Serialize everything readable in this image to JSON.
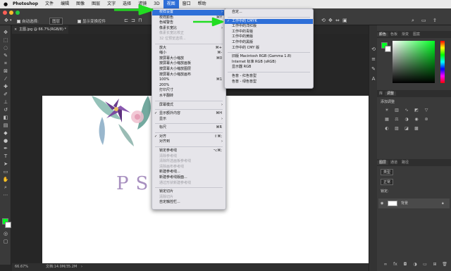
{
  "menubar": {
    "apple": "",
    "items": [
      "Photoshop",
      "文件",
      "编辑",
      "图像",
      "图层",
      "文字",
      "选择",
      "滤镜",
      "3D",
      "视图",
      "窗口",
      "帮助"
    ],
    "active_index": 9
  },
  "options_bar": {
    "auto_select_label": "自动选择:",
    "auto_select_value": "图层",
    "show_transform_label": "显示变换控件"
  },
  "document": {
    "tab_label": "主图.jpg @ 66.7%(RGB/8) *",
    "close_glyph": "×",
    "canvas_text": "PS 部落",
    "status_zoom": "66.67%",
    "status_doc": "文档:14.0M/35.2M"
  },
  "view_menu": [
    {
      "label": "校样设置",
      "arrow": "›",
      "highlight": true
    },
    {
      "label": "校样颜色",
      "shortcut": "⌘Y"
    },
    {
      "label": "色域警告",
      "shortcut": "⇧⌘Y"
    },
    {
      "label": "像素长宽比",
      "arrow": "›"
    },
    {
      "label": "像素长宽比校正",
      "disabled": true
    },
    {
      "label": "32 位预览选项...",
      "disabled": true
    },
    {
      "sep": true
    },
    {
      "label": "放大",
      "shortcut": "⌘+"
    },
    {
      "label": "缩小",
      "shortcut": "⌘-"
    },
    {
      "label": "按屏幕大小缩放",
      "shortcut": "⌘0"
    },
    {
      "label": "按屏幕大小缩放画板"
    },
    {
      "label": "按屏幕大小缩放图层"
    },
    {
      "label": "按屏幕大小缩放画布"
    },
    {
      "label": "100%",
      "shortcut": "⌘1"
    },
    {
      "label": "200%"
    },
    {
      "label": "打印尺寸"
    },
    {
      "label": "水平翻转"
    },
    {
      "sep": true
    },
    {
      "label": "屏幕模式",
      "arrow": "›"
    },
    {
      "sep": true
    },
    {
      "label": "显示额外内容",
      "shortcut": "⌘H",
      "check": "✓"
    },
    {
      "label": "显示",
      "arrow": "›"
    },
    {
      "sep": true
    },
    {
      "label": "标尺",
      "shortcut": "⌘R"
    },
    {
      "sep": true
    },
    {
      "label": "对齐",
      "shortcut": "⇧⌘;",
      "check": "✓"
    },
    {
      "label": "对齐到",
      "arrow": "›"
    },
    {
      "sep": true
    },
    {
      "label": "锁定参考线",
      "shortcut": "⌥⌘;"
    },
    {
      "label": "清除参考线",
      "disabled": true
    },
    {
      "label": "清除所选画板参考线",
      "disabled": true
    },
    {
      "label": "清除画布参考线",
      "disabled": true
    },
    {
      "label": "新建参考线..."
    },
    {
      "label": "新建参考线版面..."
    },
    {
      "label": "通过形状新建参考线",
      "disabled": true
    },
    {
      "sep": true
    },
    {
      "label": "锁定切片"
    },
    {
      "label": "清除切片",
      "disabled": true
    },
    {
      "label": "自定触控栏..."
    }
  ],
  "proof_submenu": [
    {
      "label": "自定..."
    },
    {
      "sep": true
    },
    {
      "label": "工作中的 CMYK",
      "check": "✓",
      "highlight": true
    },
    {
      "label": "工作中的洋红版"
    },
    {
      "label": "工作中的青版"
    },
    {
      "label": "工作中的黄版"
    },
    {
      "label": "工作中的黑版"
    },
    {
      "label": "工作中的 CMY 版"
    },
    {
      "sep": true
    },
    {
      "label": "旧版 Macintosh RGB (Gamma 1.8)"
    },
    {
      "label": "Internet 标准 RGB (sRGB)"
    },
    {
      "label": "显示器 RGB"
    },
    {
      "sep": true
    },
    {
      "label": "色盲 - 红色盲型"
    },
    {
      "label": "色盲 - 绿色盲型"
    }
  ],
  "panels": {
    "color_tabs": [
      "颜色",
      "色板",
      "渐变",
      "图案"
    ],
    "adjust_tabs": [
      "库",
      "调整"
    ],
    "adjust_heading": "添加调整",
    "layer_tabs": [
      "图层",
      "通道",
      "路径"
    ],
    "layer_kind": "类型",
    "layer_blend": "正常",
    "layer_lock": "锁定:",
    "layer_name": "背景",
    "foreground_color": "#00ff22",
    "background_color": "#ffffff"
  },
  "colors": {
    "arrow_green": "#22dd22",
    "menu_highlight": "#2e6fd8"
  }
}
